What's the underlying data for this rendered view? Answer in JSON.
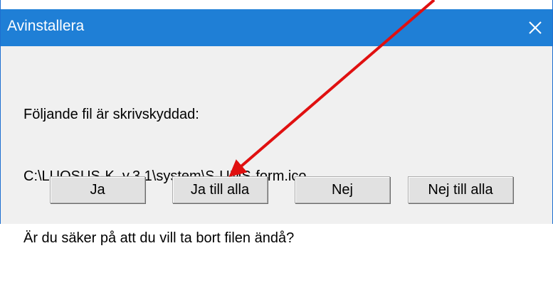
{
  "window": {
    "title": "Avinstallera",
    "close_glyph": "✕"
  },
  "message": {
    "lines": [
      "Följande fil är skrivskyddad:",
      "C:\\LUQSUS-K_v.3.1\\system\\S-UMS-form.ico",
      "Är du säker på att du vill ta bort filen ändå?"
    ]
  },
  "buttons": {
    "ja": "Ja",
    "ja_till_alla": "Ja till alla",
    "nej": "Nej",
    "nej_till_alla": "Nej till alla"
  },
  "annotation": {
    "arrow_color": "#e01010",
    "arrow_target": "Ja till alla"
  },
  "colors": {
    "titlebar": "#1f7fd6",
    "dialog_background": "#f0f0f0",
    "button_face": "#e1e1e1"
  }
}
